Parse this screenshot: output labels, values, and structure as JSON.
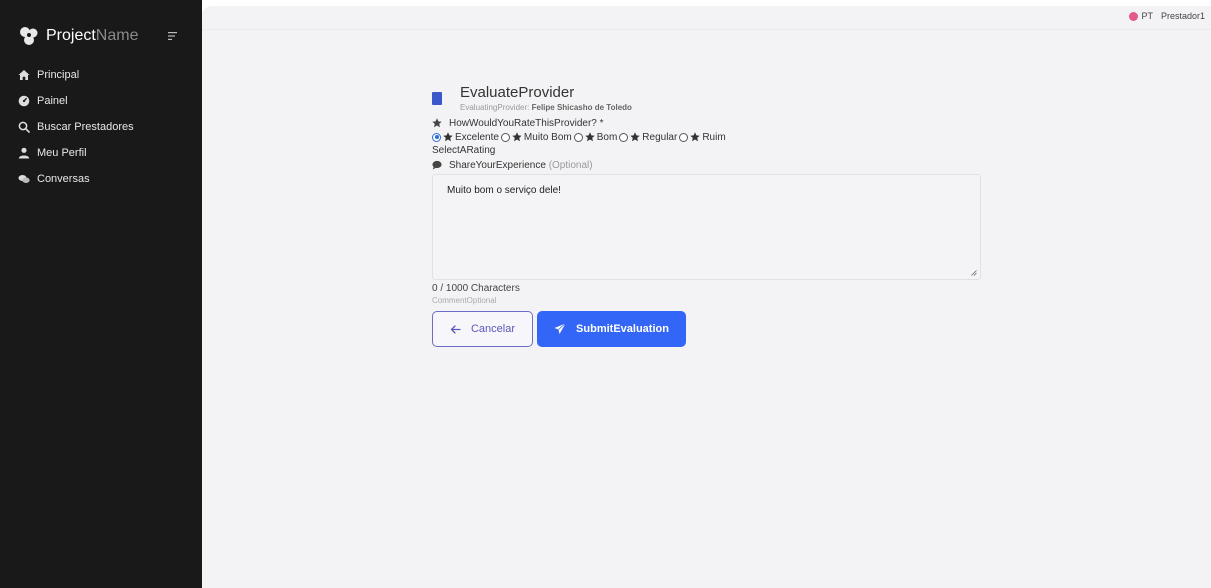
{
  "sidebar": {
    "brand_primary": "Project",
    "brand_secondary": "Name",
    "items": [
      {
        "label": "Principal",
        "icon": "home-icon"
      },
      {
        "label": "Painel",
        "icon": "dashboard-icon"
      },
      {
        "label": "Buscar Prestadores",
        "icon": "search-icon"
      },
      {
        "label": "Meu Perfil",
        "icon": "user-icon"
      },
      {
        "label": "Conversas",
        "icon": "chat-icon"
      }
    ]
  },
  "topbar": {
    "language": "PT",
    "user": "Prestador1"
  },
  "form": {
    "title": "EvaluateProvider",
    "subtitle_label": "EvaluatingProvider:",
    "provider_name": "Felipe Shicasho de Toledo",
    "question": "HowWouldYouRateThisProvider? *",
    "ratings": [
      {
        "label": "Excelente",
        "checked": true
      },
      {
        "label": "Muito Bom",
        "checked": false
      },
      {
        "label": "Bom",
        "checked": false
      },
      {
        "label": "Regular",
        "checked": false
      },
      {
        "label": "Ruim",
        "checked": false
      }
    ],
    "rating_hint": "SelectARating",
    "experience_label": "ShareYourExperience",
    "experience_optional": "(Optional)",
    "comment_text": "Muito bom o serviço dele!",
    "char_counter": "0 / 1000 Characters",
    "comment_optional": "CommentOptional",
    "cancel_label": "Cancelar",
    "submit_label": "SubmitEvaluation"
  },
  "colors": {
    "sidebar_bg": "#191919",
    "main_bg": "#f3f3f5",
    "primary": "#3366f6",
    "cancel_border": "#6f6cc9"
  }
}
